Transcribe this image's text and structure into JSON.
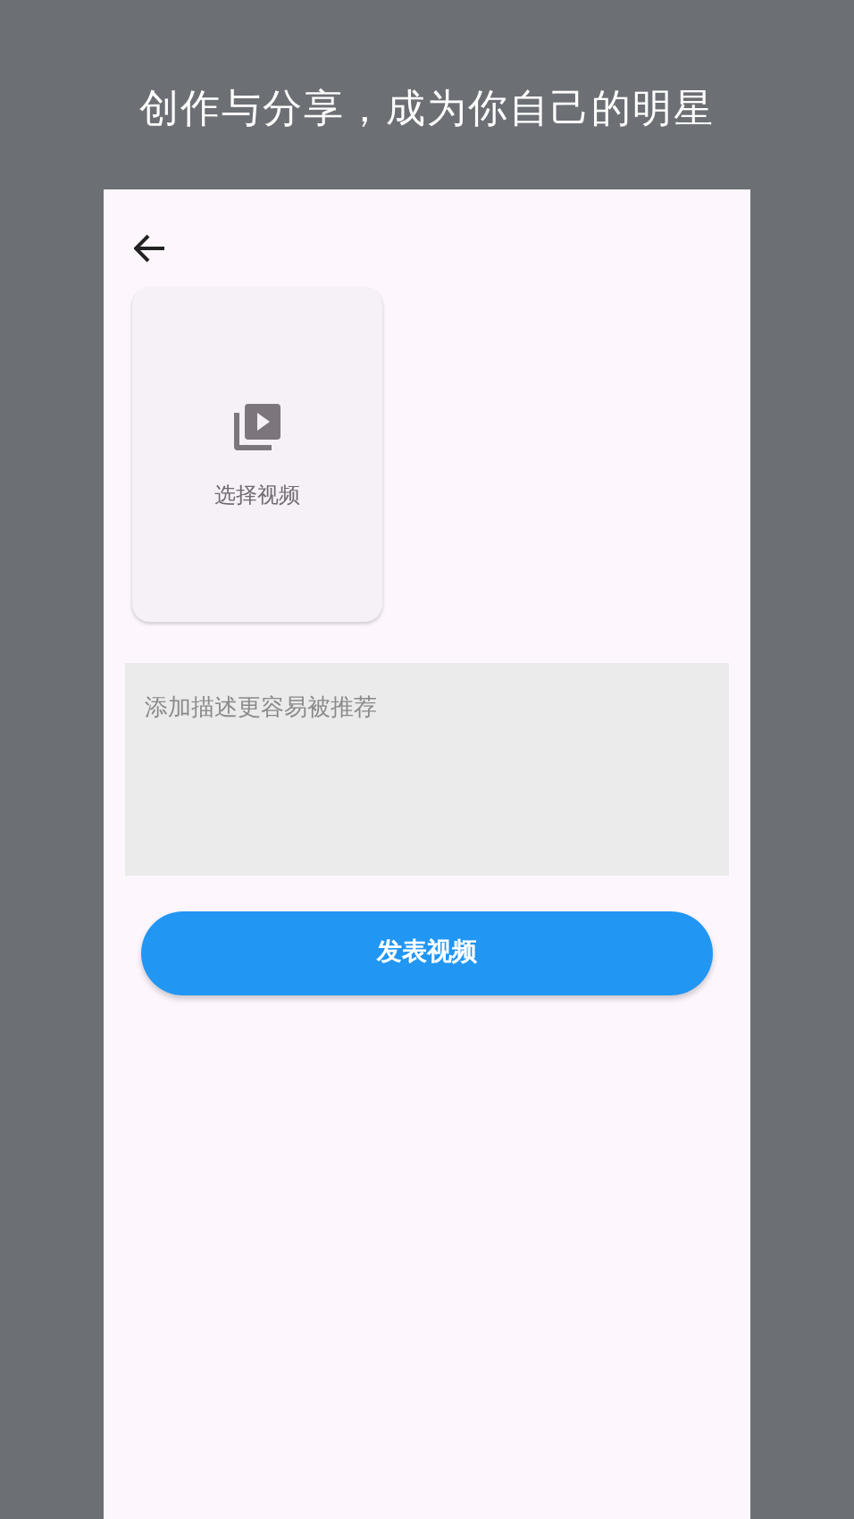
{
  "headline": "创作与分享，成为你自己的明星",
  "screen": {
    "video_picker": {
      "label": "选择视频"
    },
    "description": {
      "placeholder": "添加描述更容易被推荐"
    },
    "publish_button": {
      "label": "发表视频"
    }
  }
}
